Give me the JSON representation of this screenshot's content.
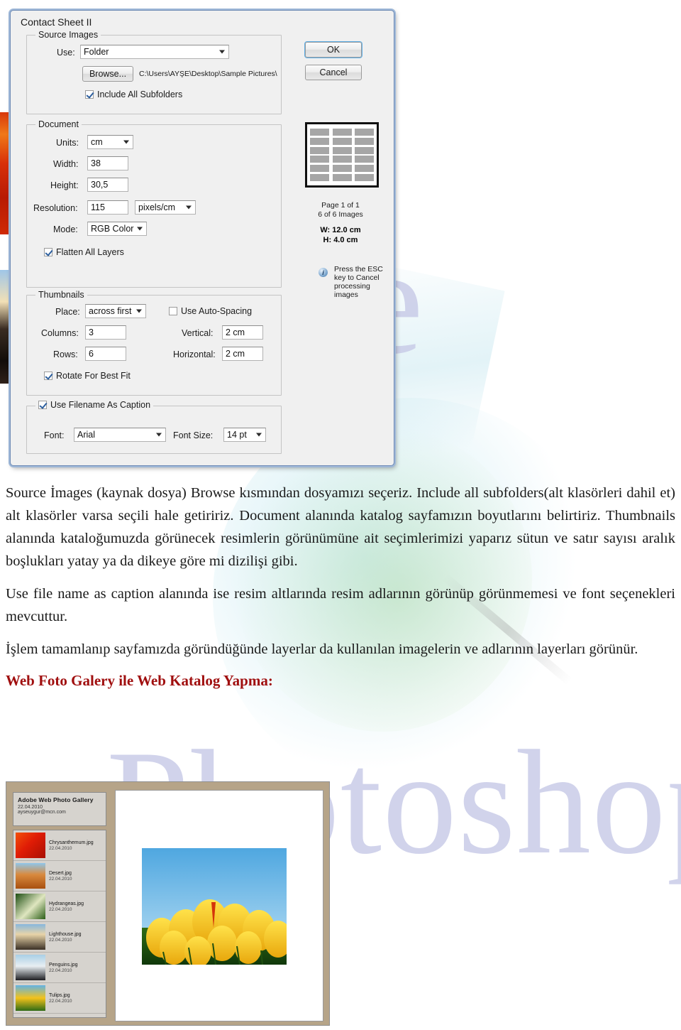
{
  "watermarks": {
    "adobe": "be",
    "photoshop": "Photoshop"
  },
  "dialog": {
    "title": "Contact Sheet II",
    "buttons": {
      "ok": "OK",
      "cancel": "Cancel",
      "browse": "Browse..."
    },
    "source_images": {
      "legend": "Source Images",
      "use_label": "Use:",
      "use_value": "Folder",
      "path": "C:\\Users\\AYŞE\\Desktop\\Sample Pictures\\",
      "include_subfolders_label": "Include All Subfolders",
      "include_subfolders_checked": true
    },
    "document": {
      "legend": "Document",
      "units_label": "Units:",
      "units_value": "cm",
      "width_label": "Width:",
      "width_value": "38",
      "height_label": "Height:",
      "height_value": "30,5",
      "resolution_label": "Resolution:",
      "resolution_value": "115",
      "resolution_units": "pixels/cm",
      "mode_label": "Mode:",
      "mode_value": "RGB Color",
      "flatten_label": "Flatten All Layers",
      "flatten_checked": true
    },
    "thumbnails": {
      "legend": "Thumbnails",
      "place_label": "Place:",
      "place_value": "across first",
      "auto_spacing_label": "Use Auto-Spacing",
      "auto_spacing_checked": false,
      "columns_label": "Columns:",
      "columns_value": "3",
      "rows_label": "Rows:",
      "rows_value": "6",
      "vertical_label": "Vertical:",
      "vertical_value": "2 cm",
      "horizontal_label": "Horizontal:",
      "horizontal_value": "2 cm",
      "rotate_label": "Rotate For Best Fit",
      "rotate_checked": true
    },
    "caption": {
      "legend": "Use Filename As Caption",
      "legend_checked": true,
      "font_label": "Font:",
      "font_value": "Arial",
      "font_size_label": "Font Size:",
      "font_size_value": "14 pt"
    },
    "preview": {
      "page_info": "Page 1 of 1",
      "image_info": "6 of 6 Images",
      "width_info": "W: 12.0 cm",
      "height_info": "H: 4.0 cm",
      "info_icon": "i",
      "info_text": "Press the ESC key to Cancel processing images",
      "grid_rows": 6,
      "grid_cols": 3
    }
  },
  "copy": {
    "paragraph1": "Source İmages (kaynak dosya) Browse kısmından dosyamızı seçeriz. Include all subfolders(alt klasörleri dahil et) alt klasörler varsa seçili hale getiririz. Document alanında katalog sayfamızın boyutlarını belirtiriz. Thumbnails alanında kataloğumuzda görünecek resimlerin görünümüne ait seçimlerimizi yaparız sütun ve satır sayısı aralık boşlukları yatay ya da dikeye göre mi dizilişi gibi.",
    "paragraph2": "Use file name as caption alanında ise resim altlarında resim adlarının görünüp görünmemesi ve font seçenekleri mevcuttur.",
    "paragraph3": "İşlem tamamlanıp sayfamızda göründüğünde layerlar da kullanılan imagelerin ve adlarının layerları görünür.",
    "heading": "Web Foto Galery ile Web Katalog Yapma:"
  },
  "gallery": {
    "header": {
      "title": "Adobe Web Photo Gallery",
      "date": "22.04.2010",
      "email": "ayseuygur@mcn.com"
    },
    "items": [
      {
        "name": "Chrysanthemum.jpg",
        "date": "22.04.2010",
        "thumb": "chrysanthemum"
      },
      {
        "name": "Desert.jpg",
        "date": "22.04.2010",
        "thumb": "desert"
      },
      {
        "name": "Hydrangeas.jpg",
        "date": "22.04.2010",
        "thumb": "hydrangeas"
      },
      {
        "name": "Lighthouse.jpg",
        "date": "22.04.2010",
        "thumb": "lighthouse"
      },
      {
        "name": "Penguins.jpg",
        "date": "22.04.2010",
        "thumb": "penguins"
      },
      {
        "name": "Tulips.jpg",
        "date": "22.04.2010",
        "thumb": "tulips"
      }
    ],
    "main_image": "tulips"
  },
  "colors": {
    "heading_red": "#a00f0f",
    "watermark_purple": "#c9cce8",
    "dialog_bg": "#f0f0f0",
    "gallery_frame": "#b6a488"
  }
}
